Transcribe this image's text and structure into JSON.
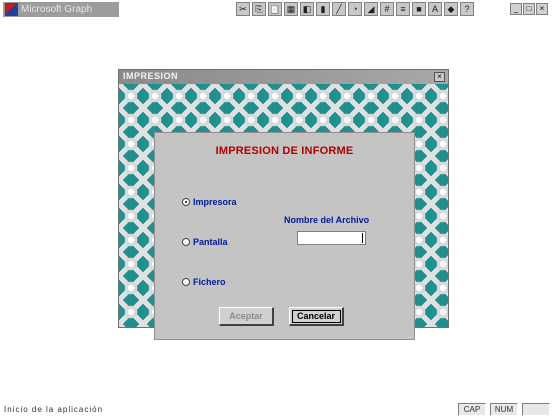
{
  "app": {
    "title": "Microsoft Graph",
    "toolbar_icons": [
      "cut-icon",
      "copy-icon",
      "paste-icon",
      "table-icon",
      "chart-icon",
      "bar-chart-icon",
      "line-chart-icon",
      "pie-chart-icon",
      "area-chart-icon",
      "grid-icon",
      "legend-icon",
      "color-icon",
      "font-icon",
      "shapes-icon",
      "help-icon"
    ],
    "window_controls": [
      "_",
      "□",
      "×"
    ]
  },
  "dialog": {
    "title": "IMPRESION",
    "close_label": "×",
    "heading": "IMPRESION DE INFORME",
    "options": [
      {
        "label": "Impresora",
        "checked": true
      },
      {
        "label": "Pantalla",
        "checked": false
      },
      {
        "label": "Fichero",
        "checked": false
      }
    ],
    "file_label": "Nombre del Archivo",
    "file_value": "",
    "accept_label": "Aceptar",
    "cancel_label": "Cancelar"
  },
  "status": {
    "text": "Inicio de la aplicación",
    "boxes": [
      "CAP",
      "NUM",
      ""
    ]
  },
  "colors": {
    "heading": "#b00000",
    "labels": "#001a9a",
    "frame": "#1f8f8f",
    "panel": "#c4c4c4"
  }
}
